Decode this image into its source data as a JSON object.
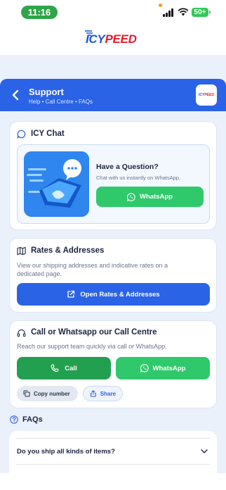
{
  "status_bar": {
    "time": "11:16",
    "battery": "50+"
  },
  "brand": {
    "logo_icy": "ICY",
    "logo_peed": "PEED",
    "mini_icy": "ICY",
    "mini_peed": "PEED"
  },
  "header": {
    "title": "Support",
    "subtitle": "Help • Call Centre • FAQs"
  },
  "icy_chat": {
    "title": "ICY Chat",
    "question_title": "Have a Question?",
    "question_sub": "Chat with us instantly on WhatsApp.",
    "whatsapp_label": "WhatsApp"
  },
  "rates": {
    "title": "Rates & Addresses",
    "description": "View our shipping addresses and indicative rates on a dedicated page.",
    "button_label": "Open Rates & Addresses"
  },
  "call_centre": {
    "title": "Call or Whatsapp our Call Centre",
    "description": "Reach our support team quickly via call or WhatsApp.",
    "call_label": "Call",
    "whatsapp_label": "WhatsApp",
    "copy_label": "Copy number",
    "share_label": "Share"
  },
  "faqs": {
    "title": "FAQs",
    "items": [
      {
        "question": "Do you ship all kinds of items?"
      }
    ]
  },
  "colors": {
    "primary": "#2b63e6",
    "whatsapp": "#2fc96b",
    "call": "#23a04f",
    "brand_red": "#e11d2e"
  }
}
